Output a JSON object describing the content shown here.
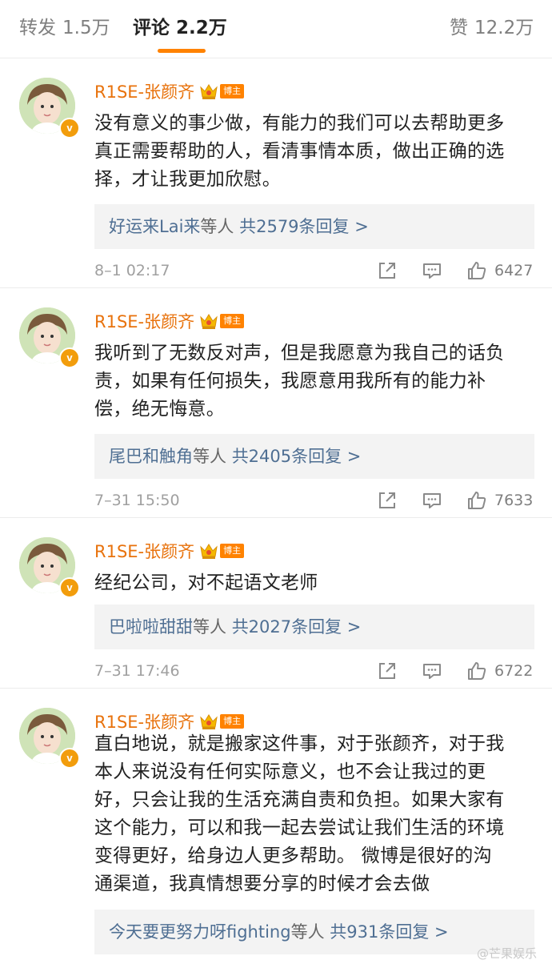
{
  "tabs": {
    "repost": {
      "label": "转发",
      "count": "1.5万"
    },
    "comments": {
      "label": "评论",
      "count": "2.2万"
    },
    "likes": {
      "label": "赞",
      "count": "12.2万"
    }
  },
  "colors": {
    "accent": "#ff8200",
    "username": "#e8720c",
    "link": "#4f6f93"
  },
  "icons": {
    "verified": "verified-v-icon",
    "crown": "crown-icon",
    "share": "share-icon",
    "comment": "comment-icon",
    "like": "thumbs-up-icon"
  },
  "comments": [
    {
      "username": "R1SE-张颜齐",
      "badge": "博主",
      "verified": "v",
      "text_lines": [
        "没有意义的事少做，有能力的我们可以去帮助更多",
        "真正需要帮助的人，看清事情本质，做出正确的选",
        "择，才让我更加欣慰。"
      ],
      "reply_user": "好运来Lai来",
      "reply_mid": "等人",
      "reply_count": "共2579条回复 >",
      "time": "8–1 02:17",
      "likes": "6427"
    },
    {
      "username": "R1SE-张颜齐",
      "badge": "博主",
      "verified": "v",
      "text_lines": [
        "我听到了无数反对声，但是我愿意为我自己的话负",
        "责，如果有任何损失，我愿意用我所有的能力补",
        "偿，绝无悔意。"
      ],
      "reply_user": "尾巴和触角",
      "reply_mid": "等人",
      "reply_count": "共2405条回复 >",
      "time": "7–31 15:50",
      "likes": "7633"
    },
    {
      "username": "R1SE-张颜齐",
      "badge": "博主",
      "verified": "v",
      "text_lines": [
        "经纪公司，对不起语文老师"
      ],
      "reply_user": "巴啦啦甜甜",
      "reply_mid": "等人",
      "reply_count": "共2027条回复 >",
      "time": "7–31 17:46",
      "likes": "6722"
    },
    {
      "username": "R1SE-张颜齐",
      "badge": "博主",
      "verified": "v",
      "text_lines": [
        "直白地说，就是搬家这件事，对于张颜齐，对于我",
        "本人来说没有任何实际意义，也不会让我过的更",
        "好，只会让我的生活充满自责和负担。如果大家有",
        "这个能力，可以和我一起去尝试让我们生活的环境",
        "变得更好，给身边人更多帮助。 微博是很好的沟",
        "通渠道，我真情想要分享的时候才会去做"
      ],
      "reply_user": "今天要更努力呀fighting",
      "reply_mid": "等人",
      "reply_count": "共931条回复 >"
    }
  ],
  "watermark": "@芒果娱乐"
}
